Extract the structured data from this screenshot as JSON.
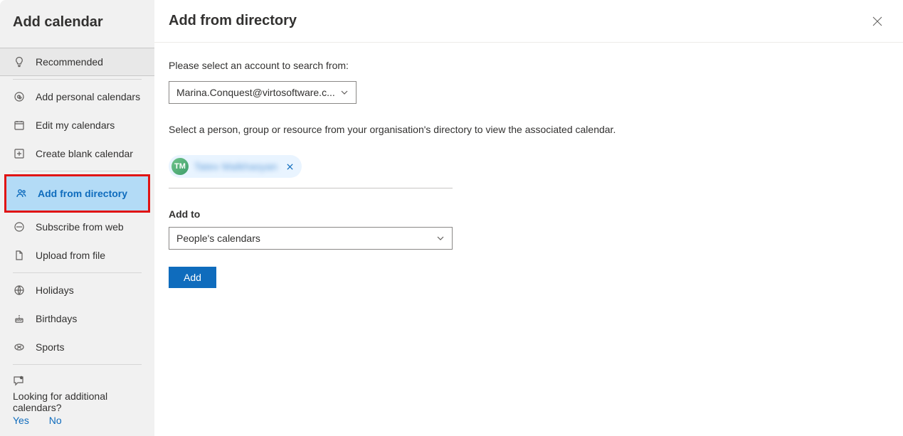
{
  "sidebar": {
    "title": "Add calendar",
    "recommended": "Recommended",
    "items": {
      "personal": "Add personal calendars",
      "edit": "Edit my calendars",
      "blank": "Create blank calendar",
      "directory": "Add from directory",
      "subscribe": "Subscribe from web",
      "upload": "Upload from file",
      "holidays": "Holidays",
      "birthdays": "Birthdays",
      "sports": "Sports"
    },
    "feedback": {
      "prompt": "Looking for additional calendars?",
      "yes": "Yes",
      "no": "No"
    }
  },
  "main": {
    "title": "Add from directory",
    "account_prompt": "Please select an account to search from:",
    "account_value": "Marina.Conquest@virtosoftware.c...",
    "directory_help": "Select a person, group or resource from your organisation's directory to view the associated calendar.",
    "chip": {
      "initials": "TM",
      "name": "Tatev Malkhasyan"
    },
    "addto_label": "Add to",
    "addto_value": "People's calendars",
    "add_button": "Add"
  }
}
